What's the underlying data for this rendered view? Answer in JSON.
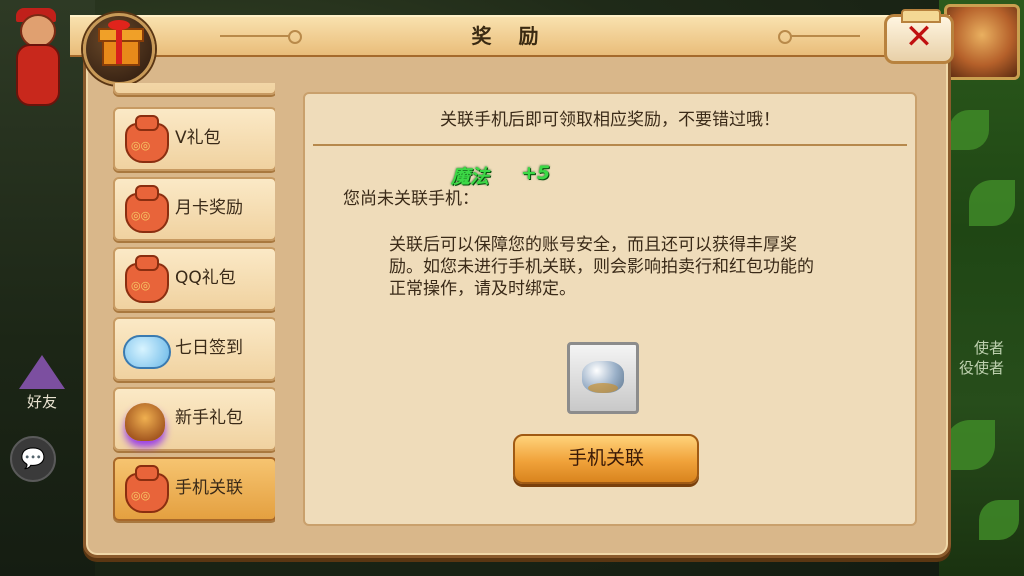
{
  "title": "奖 励",
  "close_label": "✕",
  "sidebar": {
    "items": [
      {
        "label": "V礼包",
        "icon": "red-bag-icon",
        "active": false
      },
      {
        "label": "月卡奖励",
        "icon": "red-bag-icon",
        "active": false
      },
      {
        "label": "QQ礼包",
        "icon": "red-bag-icon",
        "active": false
      },
      {
        "label": "七日签到",
        "icon": "blue-cloud-icon",
        "active": false
      },
      {
        "label": "新手礼包",
        "icon": "treasure-icon",
        "active": false
      },
      {
        "label": "手机关联",
        "icon": "red-bag-icon",
        "active": true
      }
    ]
  },
  "content": {
    "notice": "关联手机后即可领取相应奖励，不要错过哦！",
    "status": "您尚未关联手机：",
    "description": "关联后可以保障您的账号安全，而且还可以获得丰厚奖励。如您未进行手机关联，则会影响拍卖行和红包功能的正常操作，请及时绑定。",
    "float_text": {
      "label": "魔法",
      "value": "+5"
    },
    "reward_icon": "silver-ingot-icon",
    "bind_button": "手机关联"
  },
  "background": {
    "friend_label": "好友",
    "chat_icon": "chat-bubble-icon",
    "right_text_1": "使者",
    "right_text_2": "役使者"
  },
  "colors": {
    "panel": "#d9b78a",
    "content_bg": "#efdcba",
    "button": "#f0a23a",
    "float_green": "#3cd846",
    "close_red": "#c01010"
  }
}
